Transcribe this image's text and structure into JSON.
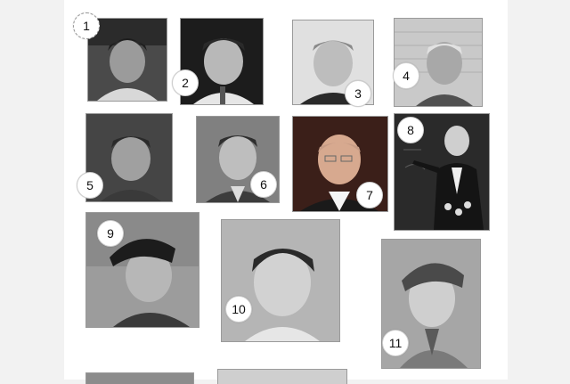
{
  "photos": [
    {
      "label": "1"
    },
    {
      "label": "2"
    },
    {
      "label": "3"
    },
    {
      "label": "4"
    },
    {
      "label": "5"
    },
    {
      "label": "6"
    },
    {
      "label": "7"
    },
    {
      "label": "8"
    },
    {
      "label": "9"
    },
    {
      "label": "10"
    },
    {
      "label": "11"
    }
  ]
}
